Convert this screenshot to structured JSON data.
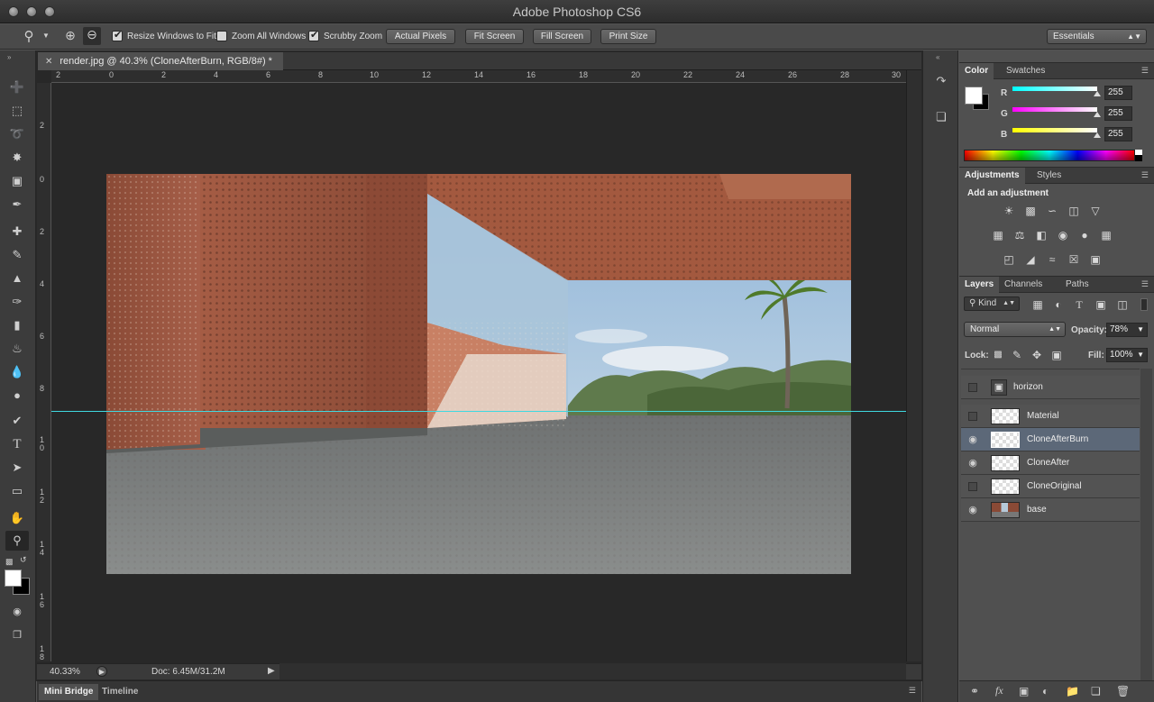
{
  "window": {
    "title": "Adobe Photoshop CS6"
  },
  "options": {
    "resize_windows": "Resize Windows to Fit",
    "zoom_all": "Zoom All Windows",
    "scrubby_zoom": "Scrubby Zoom",
    "actual_pixels": "Actual Pixels",
    "fit_screen": "Fit Screen",
    "fill_screen": "Fill Screen",
    "print_size": "Print Size",
    "workspace": "Essentials"
  },
  "document": {
    "tab_label": "render.jpg @ 40.3% (CloneAfterBurn, RGB/8#) *",
    "zoom": "40.33%",
    "doc_size": "Doc: 6.45M/31.2M",
    "hruler": [
      "2",
      "0",
      "2",
      "4",
      "6",
      "8",
      "10",
      "12",
      "14",
      "16",
      "18",
      "20",
      "22",
      "24",
      "26",
      "28",
      "30"
    ],
    "vruler": [
      "2",
      "0",
      "2",
      "4",
      "6",
      "8",
      "1\n0",
      "1\n2",
      "1\n4",
      "1\n6",
      "1\n8"
    ]
  },
  "bottom_tabs": {
    "mini_bridge": "Mini Bridge",
    "timeline": "Timeline"
  },
  "color_panel": {
    "tab_color": "Color",
    "tab_swatches": "Swatches",
    "r_label": "R",
    "g_label": "G",
    "b_label": "B",
    "r": "255",
    "g": "255",
    "b": "255"
  },
  "adjustments_panel": {
    "tab_adjustments": "Adjustments",
    "tab_styles": "Styles",
    "heading": "Add an adjustment"
  },
  "layers_panel": {
    "tab_layers": "Layers",
    "tab_channels": "Channels",
    "tab_paths": "Paths",
    "filter_kind": "Kind",
    "blend_mode": "Normal",
    "opacity_label": "Opacity:",
    "opacity": "78%",
    "lock_label": "Lock:",
    "fill_label": "Fill:",
    "fill": "100%",
    "layers": [
      {
        "name": "horizon",
        "visible": false
      },
      {
        "name": "Material",
        "visible": false
      },
      {
        "name": "CloneAfterBurn",
        "visible": true,
        "selected": true
      },
      {
        "name": "CloneAfter",
        "visible": true
      },
      {
        "name": "CloneOriginal",
        "visible": false
      },
      {
        "name": "base",
        "visible": true
      }
    ]
  },
  "colors": {
    "selection": "#5c6878",
    "guide": "#3fd9e0",
    "panel": "#505050"
  }
}
